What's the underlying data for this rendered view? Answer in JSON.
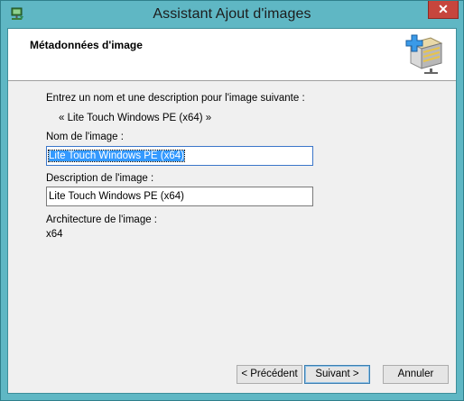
{
  "window": {
    "title": "Assistant Ajout d'images",
    "close_label": "✕",
    "app_icon": "wds-app-icon"
  },
  "header": {
    "title": "Métadonnées d'image",
    "icon": "add-image-icon"
  },
  "content": {
    "intro": "Entrez un nom et une description pour l'image suivante :",
    "source_image": "« Lite Touch Windows PE (x64) »",
    "name_label": "Nom de l'image :",
    "name_value": "Lite Touch Windows PE (x64)",
    "description_label": "Description de l'image :",
    "description_value": "Lite Touch Windows PE (x64)",
    "architecture_label": "Architecture de l'image :",
    "architecture_value": "x64"
  },
  "buttons": {
    "back": "< Précédent",
    "next": "Suivant >",
    "cancel": "Annuler"
  },
  "colors": {
    "titlebar": "#5fb7c4",
    "close_button": "#c7463d",
    "selection": "#3399ff"
  }
}
